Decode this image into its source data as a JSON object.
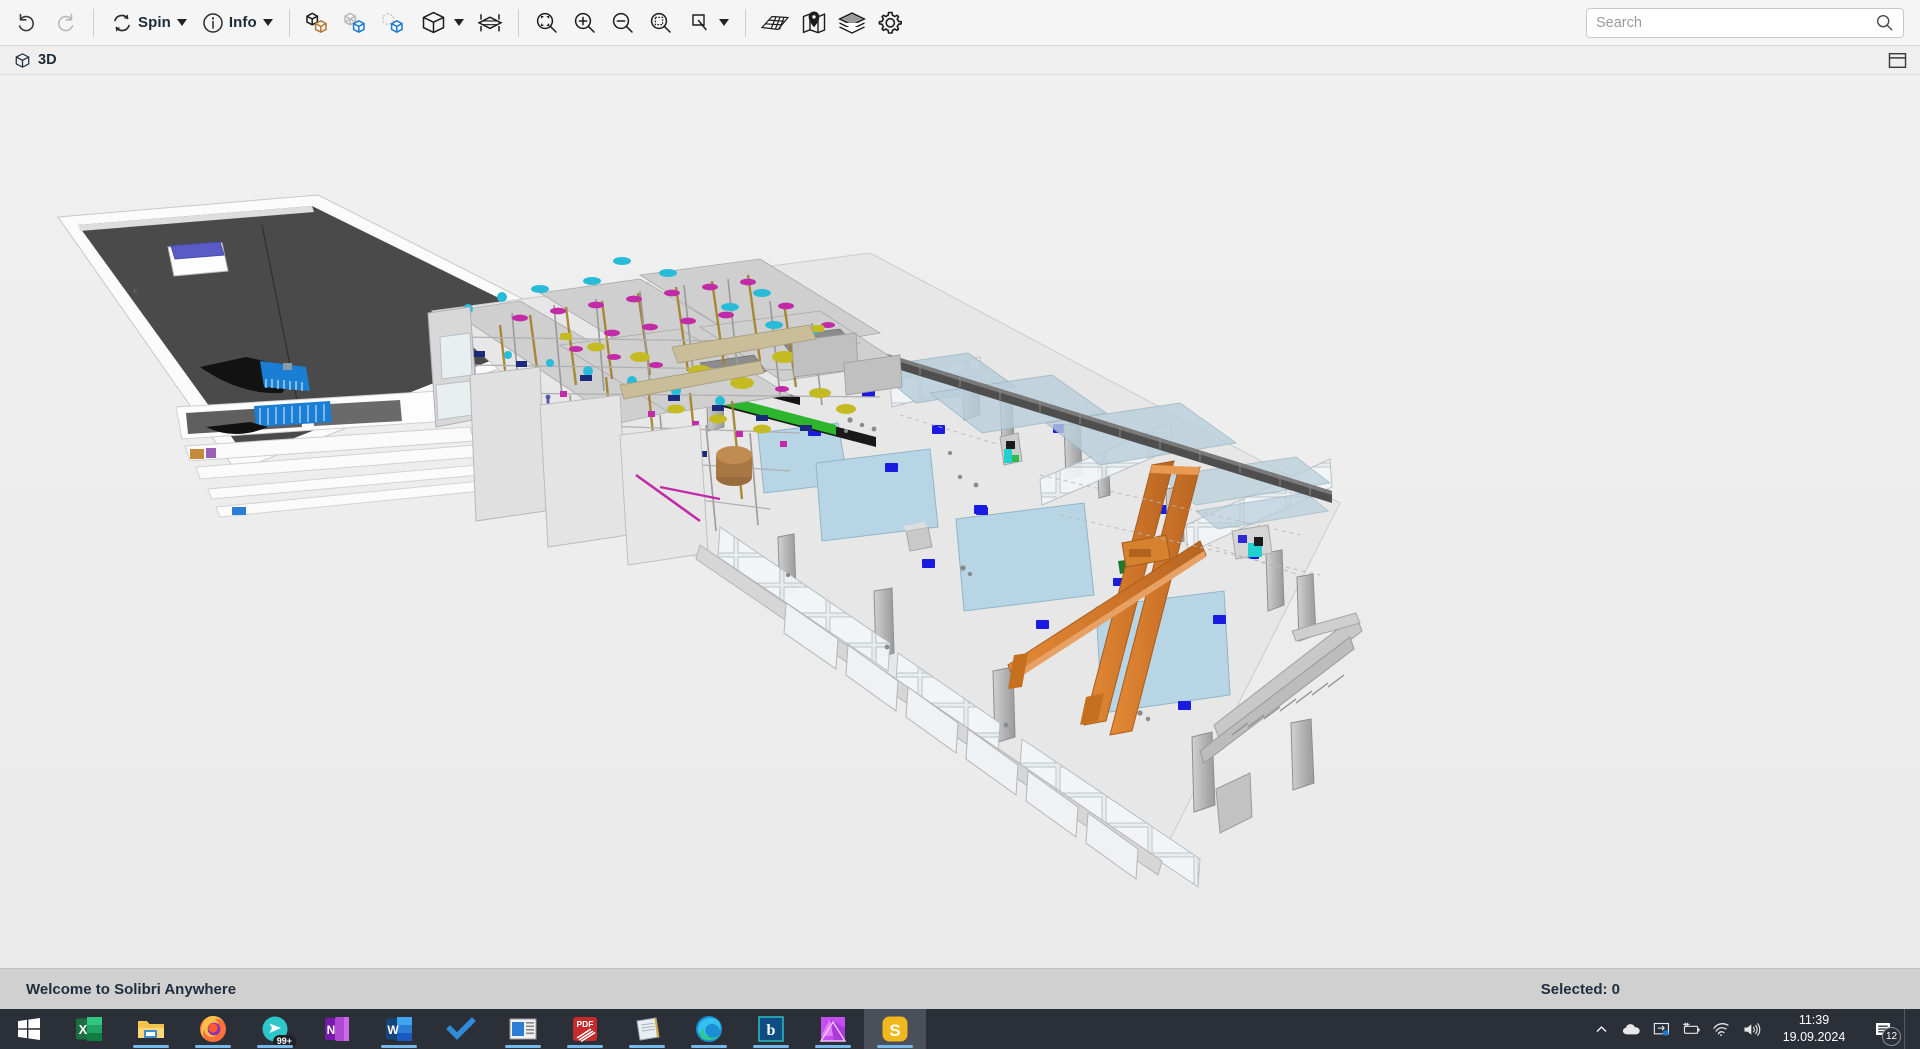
{
  "app": {
    "name": "Solibri Anywhere"
  },
  "toolbar": {
    "undo": {
      "label": "Undo",
      "icon": "undo-icon"
    },
    "redo": {
      "label": "Redo",
      "icon": "redo-icon"
    },
    "spin": {
      "label": "Spin",
      "icon": "spin-icon",
      "has_caret": true
    },
    "info": {
      "label": "Info",
      "icon": "info-icon",
      "has_caret": true
    },
    "show_hide": {
      "label": "Show/Hide",
      "icon": "two-cubes-icon"
    },
    "transparent": {
      "label": "Transparent",
      "icon": "transparent-cube-icon"
    },
    "hidden": {
      "label": "Hidden",
      "icon": "dashed-cube-icon"
    },
    "solid": {
      "label": "Solid",
      "icon": "solid-cube-icon",
      "has_caret": true
    },
    "section": {
      "label": "Section",
      "icon": "section-box-icon"
    },
    "fit_to_view": {
      "label": "Fit to View",
      "icon": "zoom-fit-icon"
    },
    "zoom_in": {
      "label": "Zoom In",
      "icon": "zoom-in-icon"
    },
    "zoom_out": {
      "label": "Zoom Out",
      "icon": "zoom-out-icon"
    },
    "zoom_area": {
      "label": "Zoom Area",
      "icon": "zoom-area-icon"
    },
    "selection": {
      "label": "Selection Mode",
      "icon": "pick-tool-icon",
      "has_caret": true
    },
    "grid": {
      "label": "Grid",
      "icon": "grid-plane-icon"
    },
    "map": {
      "label": "Map",
      "icon": "map-pin-icon"
    },
    "layers": {
      "label": "Layers",
      "icon": "layers-icon"
    },
    "settings": {
      "label": "Settings",
      "icon": "gear-icon"
    }
  },
  "search": {
    "value": "",
    "placeholder": "Search",
    "icon": "search-icon"
  },
  "view": {
    "tab_label": "3D",
    "tab_icon": "cube-icon",
    "panel_toggle_icon": "panel-layout-icon"
  },
  "status": {
    "message": "Welcome to Solibri Anywhere",
    "selected": "Selected: 0"
  },
  "scene": {
    "background": "#ededed",
    "description": "3D BIM model of an industrial plant building",
    "palette": {
      "background": "#ededed",
      "slab_light": "#e8e8e8",
      "slab_blue": "#b7d4e4",
      "roof_dark": "#4a4a4a",
      "crane_orange": "#d9802b",
      "marker_blue": "#1414e6",
      "accent_green": "#1faa1f",
      "accent_cyan": "#2fd0d0",
      "accent_magenta": "#cc27a8",
      "accent_yellow": "#c8bf22",
      "glass_blue": "#a9c8d8",
      "steel_gray": "#b4b4b4"
    }
  },
  "taskbar": {
    "start": {
      "label": "Start",
      "icon": "windows-logo-icon"
    },
    "apps": [
      {
        "name": "excel",
        "label": "Excel",
        "icon": "excel-icon",
        "running": false,
        "active": false,
        "badge": ""
      },
      {
        "name": "file-explorer",
        "label": "File Explorer",
        "icon": "folder-icon",
        "running": true,
        "active": false,
        "badge": ""
      },
      {
        "name": "firefox",
        "label": "Firefox",
        "icon": "firefox-icon",
        "running": true,
        "active": false,
        "badge": ""
      },
      {
        "name": "teams",
        "label": "Teams",
        "icon": "teams-icon",
        "running": true,
        "active": false,
        "badge": "99+"
      },
      {
        "name": "onenote",
        "label": "OneNote",
        "icon": "onenote-icon",
        "running": false,
        "active": false,
        "badge": ""
      },
      {
        "name": "word",
        "label": "Word",
        "icon": "word-icon",
        "running": true,
        "active": false,
        "badge": ""
      },
      {
        "name": "todo",
        "label": "To Do",
        "icon": "checkmark-icon",
        "running": false,
        "active": false,
        "badge": ""
      },
      {
        "name": "publisher",
        "label": "Publisher",
        "icon": "window-doc-icon",
        "running": true,
        "active": false,
        "badge": ""
      },
      {
        "name": "pdf-xchange",
        "label": "PDF-XChange Editor",
        "icon": "pdf-icon",
        "running": true,
        "active": false,
        "badge": ""
      },
      {
        "name": "notepad",
        "label": "Notepad",
        "icon": "notepad-icon",
        "running": true,
        "active": false,
        "badge": ""
      },
      {
        "name": "edge",
        "label": "Microsoft Edge",
        "icon": "edge-icon",
        "running": true,
        "active": false,
        "badge": ""
      },
      {
        "name": "bricscad",
        "label": "BricsCAD",
        "icon": "bricscad-icon",
        "running": true,
        "active": false,
        "badge": ""
      },
      {
        "name": "affinity-photo",
        "label": "Affinity Photo",
        "icon": "affinity-icon",
        "running": true,
        "active": false,
        "badge": ""
      },
      {
        "name": "solibri",
        "label": "Solibri Anywhere",
        "icon": "solibri-icon",
        "running": true,
        "active": true,
        "badge": ""
      }
    ],
    "tray": [
      {
        "name": "show-hidden-icons",
        "icon": "chevron-up-icon"
      },
      {
        "name": "onedrive",
        "icon": "cloud-icon"
      },
      {
        "name": "display-settings",
        "icon": "screen-icon"
      },
      {
        "name": "battery",
        "icon": "battery-charging-icon"
      },
      {
        "name": "network",
        "icon": "wifi-icon"
      },
      {
        "name": "volume",
        "icon": "speaker-icon"
      }
    ],
    "clock": {
      "time": "11:39",
      "date": "19.09.2024"
    },
    "notifications": {
      "icon": "notification-icon",
      "count": "12"
    },
    "show_desktop": {
      "label": "Show desktop"
    }
  }
}
